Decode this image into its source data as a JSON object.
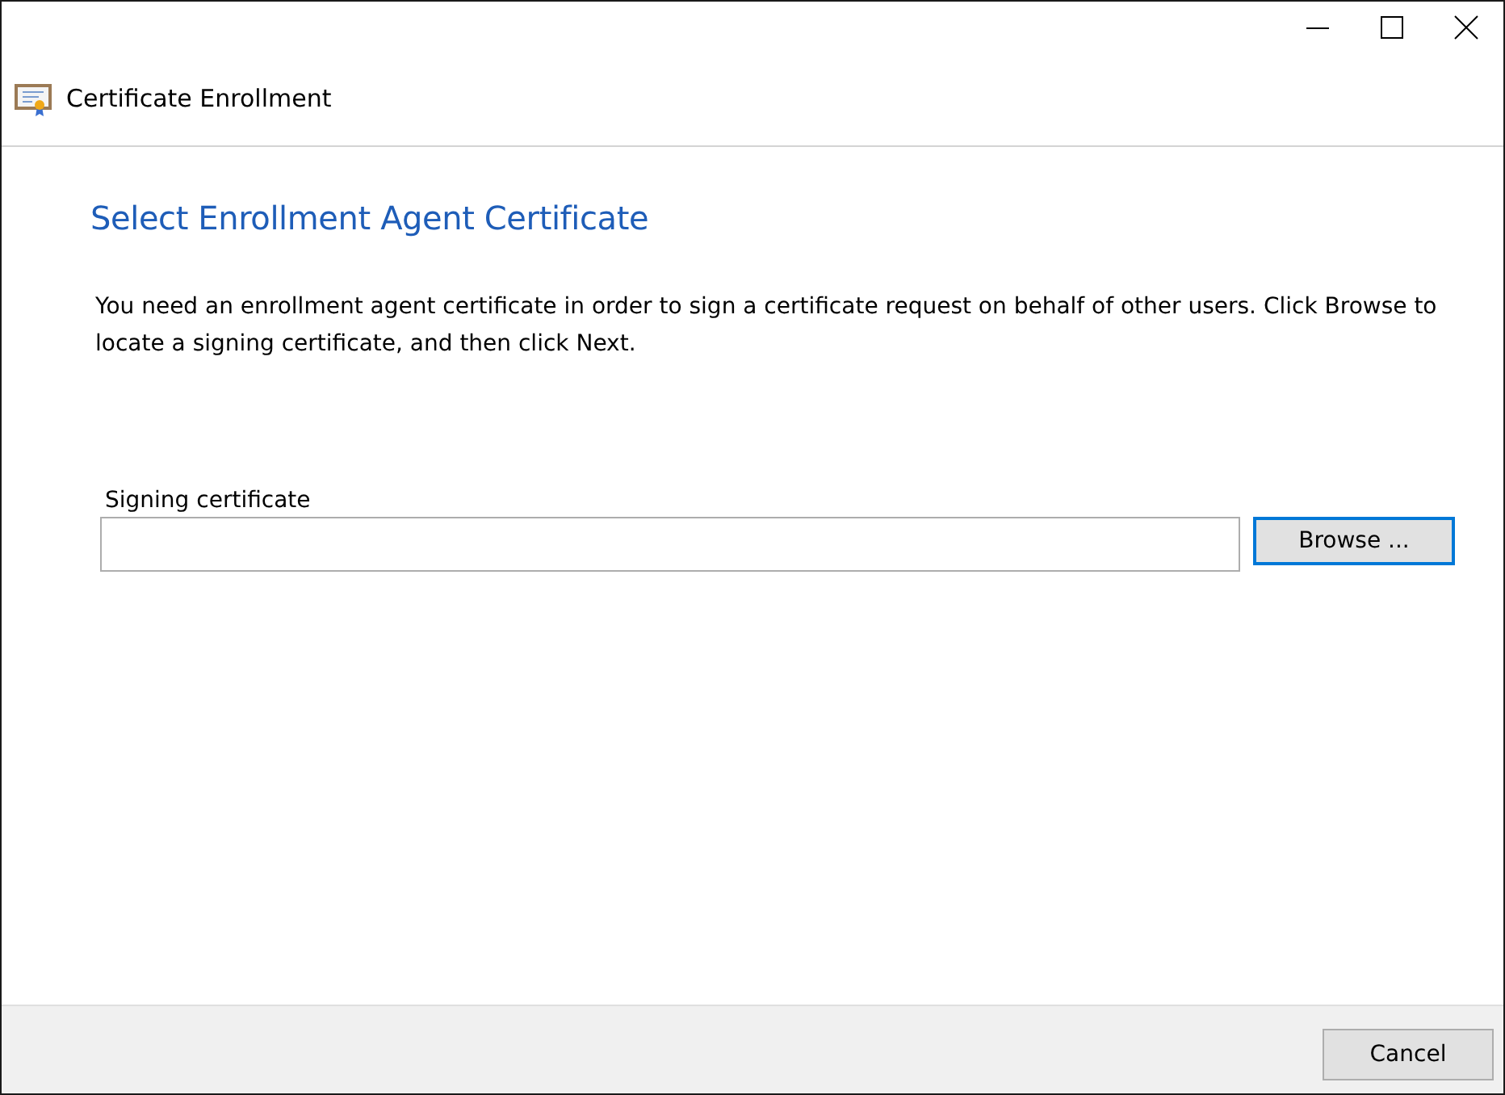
{
  "window": {
    "title": "Certificate Enrollment"
  },
  "heading": "Select Enrollment Agent Certificate",
  "description": "You need an enrollment agent certificate in order to sign a certificate request on behalf of other users. Click Browse to locate a signing certificate, and then click Next.",
  "signing_certificate": {
    "label": "Signing certificate",
    "button": {
      "label": "Browse ...",
      "focused": true
    }
  },
  "footer": {
    "buttons": [
      {
        "label": "Cancel",
        "focused": false
      }
    ]
  }
}
